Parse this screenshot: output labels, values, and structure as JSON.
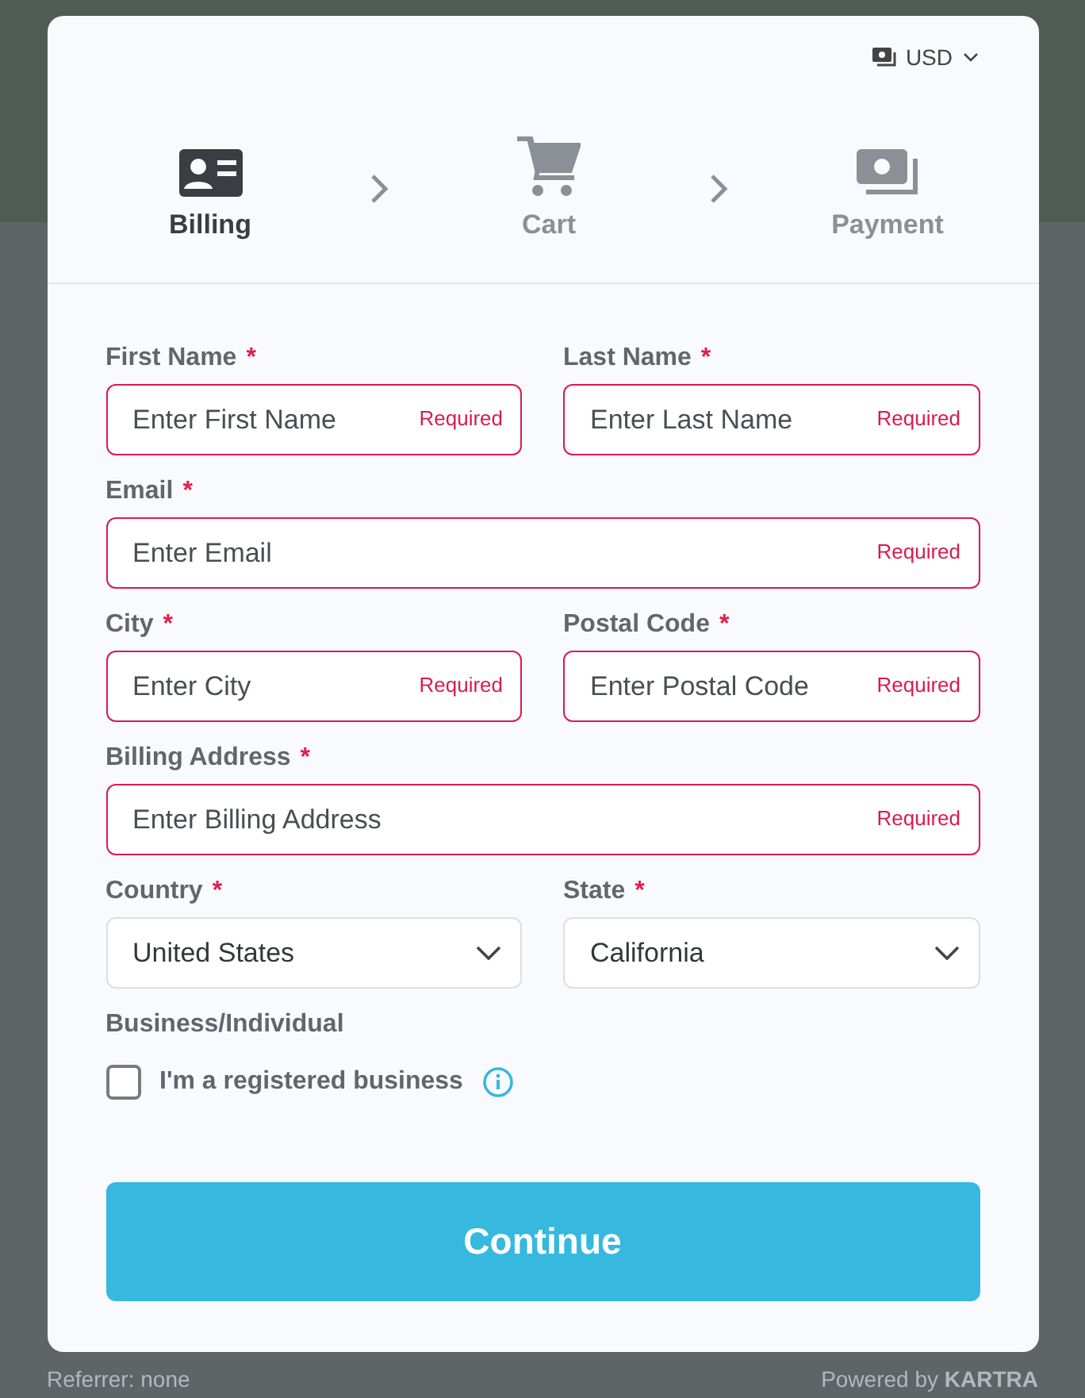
{
  "currency": {
    "label": "USD"
  },
  "steps": [
    {
      "label": "Billing",
      "kind": "id-card",
      "selected": true
    },
    {
      "label": "Cart",
      "kind": "cart",
      "selected": false
    },
    {
      "label": "Payment",
      "kind": "cash",
      "selected": false
    }
  ],
  "form_rows": [
    [
      {
        "label": "First Name",
        "marker": "*",
        "kind": "input",
        "placeholder": "Enter First Name",
        "hint": "Required"
      },
      {
        "label": "Last Name",
        "marker": "*",
        "kind": "input",
        "placeholder": "Enter Last Name",
        "hint": "Required"
      }
    ],
    [
      {
        "label": "Email",
        "marker": "*",
        "kind": "input",
        "placeholder": "Enter Email",
        "hint": "Required"
      }
    ],
    [
      {
        "label": "City",
        "marker": "*",
        "kind": "input",
        "placeholder": "Enter City",
        "hint": "Required"
      },
      {
        "label": "Postal Code",
        "marker": "*",
        "kind": "input",
        "placeholder": "Enter Postal Code",
        "hint": "Required"
      }
    ],
    [
      {
        "label": "Billing Address",
        "marker": "*",
        "kind": "input",
        "placeholder": "Enter Billing Address",
        "hint": "Required"
      }
    ],
    [
      {
        "label": "Country",
        "marker": "*",
        "kind": "select",
        "value": "United States"
      },
      {
        "label": "State",
        "marker": "*",
        "kind": "select",
        "value": "California"
      }
    ]
  ],
  "business": {
    "section_label": "Business/Individual",
    "label": "I'm a registered business",
    "checked": false
  },
  "submit": "Continue",
  "footer": {
    "referrer": "Referrer: none",
    "powered": "Powered by **KARTRA**"
  }
}
